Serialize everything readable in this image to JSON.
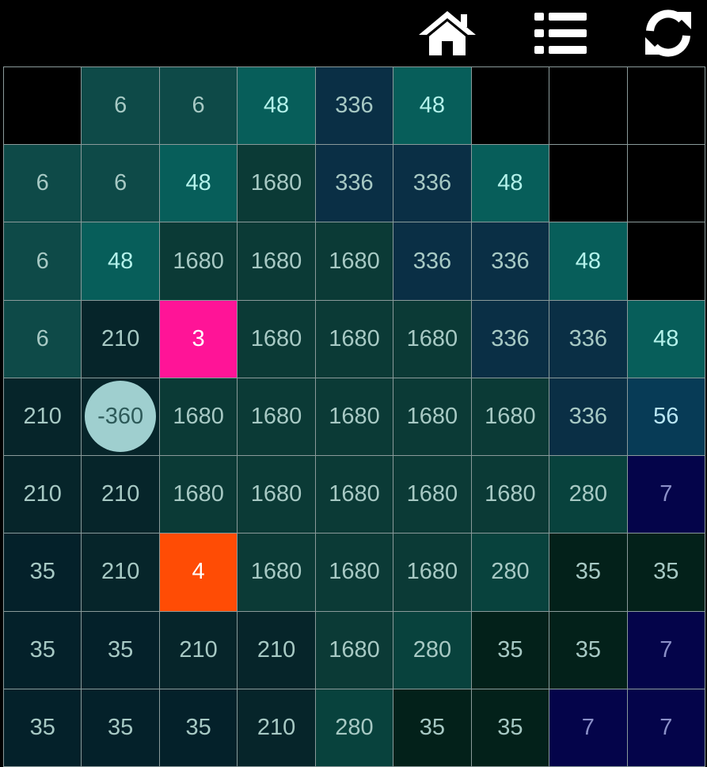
{
  "toolbar": {
    "buttons": [
      {
        "name": "home-button",
        "icon": "home-icon"
      },
      {
        "name": "menu-button",
        "icon": "list-icon"
      },
      {
        "name": "restart-button",
        "icon": "refresh-icon"
      }
    ]
  },
  "colors": {
    "empty": "#000000",
    "v6": "#0e4a48",
    "v48": "#075e5a",
    "v336": "#0a2f45",
    "v1680": "#0b3a36",
    "v210": "#06252a",
    "v35": "#04212a",
    "v280": "#08423d",
    "v56": "#073b56",
    "v7": "#04044a",
    "v35b": "#03211a",
    "pink": "#ff1497",
    "orange": "#ff4c05",
    "circle": "#9fcfcf"
  },
  "board": {
    "rows": [
      [
        {
          "v": "",
          "c": "empty"
        },
        {
          "v": "6",
          "c": "v6"
        },
        {
          "v": "6",
          "c": "v6"
        },
        {
          "v": "48",
          "c": "v48"
        },
        {
          "v": "336",
          "c": "v336"
        },
        {
          "v": "48",
          "c": "v48"
        },
        {
          "v": "",
          "c": "empty"
        },
        {
          "v": "",
          "c": "empty"
        },
        {
          "v": "",
          "c": "empty"
        }
      ],
      [
        {
          "v": "6",
          "c": "v6"
        },
        {
          "v": "6",
          "c": "v6"
        },
        {
          "v": "48",
          "c": "v48"
        },
        {
          "v": "1680",
          "c": "v1680"
        },
        {
          "v": "336",
          "c": "v336"
        },
        {
          "v": "336",
          "c": "v336"
        },
        {
          "v": "48",
          "c": "v48"
        },
        {
          "v": "",
          "c": "empty"
        },
        {
          "v": "",
          "c": "empty"
        }
      ],
      [
        {
          "v": "6",
          "c": "v6"
        },
        {
          "v": "48",
          "c": "v48"
        },
        {
          "v": "1680",
          "c": "v1680"
        },
        {
          "v": "1680",
          "c": "v1680"
        },
        {
          "v": "1680",
          "c": "v1680"
        },
        {
          "v": "336",
          "c": "v336"
        },
        {
          "v": "336",
          "c": "v336"
        },
        {
          "v": "48",
          "c": "v48"
        },
        {
          "v": "",
          "c": "empty"
        }
      ],
      [
        {
          "v": "6",
          "c": "v6"
        },
        {
          "v": "210",
          "c": "v210"
        },
        {
          "v": "3",
          "c": "pink"
        },
        {
          "v": "1680",
          "c": "v1680"
        },
        {
          "v": "1680",
          "c": "v1680"
        },
        {
          "v": "1680",
          "c": "v1680"
        },
        {
          "v": "336",
          "c": "v336"
        },
        {
          "v": "336",
          "c": "v336"
        },
        {
          "v": "48",
          "c": "v48"
        }
      ],
      [
        {
          "v": "210",
          "c": "v210"
        },
        {
          "v": "-360",
          "c": "v210",
          "circle": true
        },
        {
          "v": "1680",
          "c": "v1680"
        },
        {
          "v": "1680",
          "c": "v1680"
        },
        {
          "v": "1680",
          "c": "v1680"
        },
        {
          "v": "1680",
          "c": "v1680"
        },
        {
          "v": "1680",
          "c": "v1680"
        },
        {
          "v": "336",
          "c": "v336"
        },
        {
          "v": "56",
          "c": "v56"
        }
      ],
      [
        {
          "v": "210",
          "c": "v210"
        },
        {
          "v": "210",
          "c": "v210"
        },
        {
          "v": "1680",
          "c": "v1680"
        },
        {
          "v": "1680",
          "c": "v1680"
        },
        {
          "v": "1680",
          "c": "v1680"
        },
        {
          "v": "1680",
          "c": "v1680"
        },
        {
          "v": "1680",
          "c": "v1680"
        },
        {
          "v": "280",
          "c": "v280"
        },
        {
          "v": "7",
          "c": "v7"
        }
      ],
      [
        {
          "v": "35",
          "c": "v35"
        },
        {
          "v": "210",
          "c": "v210"
        },
        {
          "v": "4",
          "c": "orange"
        },
        {
          "v": "1680",
          "c": "v1680"
        },
        {
          "v": "1680",
          "c": "v1680"
        },
        {
          "v": "1680",
          "c": "v1680"
        },
        {
          "v": "280",
          "c": "v280"
        },
        {
          "v": "35",
          "c": "v35b"
        },
        {
          "v": "35",
          "c": "v35b"
        }
      ],
      [
        {
          "v": "35",
          "c": "v35"
        },
        {
          "v": "35",
          "c": "v35"
        },
        {
          "v": "210",
          "c": "v210"
        },
        {
          "v": "210",
          "c": "v210"
        },
        {
          "v": "1680",
          "c": "v1680"
        },
        {
          "v": "280",
          "c": "v280"
        },
        {
          "v": "35",
          "c": "v35b"
        },
        {
          "v": "35",
          "c": "v35b"
        },
        {
          "v": "7",
          "c": "v7"
        }
      ],
      [
        {
          "v": "35",
          "c": "v35"
        },
        {
          "v": "35",
          "c": "v35"
        },
        {
          "v": "35",
          "c": "v35"
        },
        {
          "v": "210",
          "c": "v210"
        },
        {
          "v": "280",
          "c": "v280"
        },
        {
          "v": "35",
          "c": "v35b"
        },
        {
          "v": "35",
          "c": "v35b"
        },
        {
          "v": "7",
          "c": "v7"
        },
        {
          "v": "7",
          "c": "v7"
        }
      ]
    ]
  }
}
